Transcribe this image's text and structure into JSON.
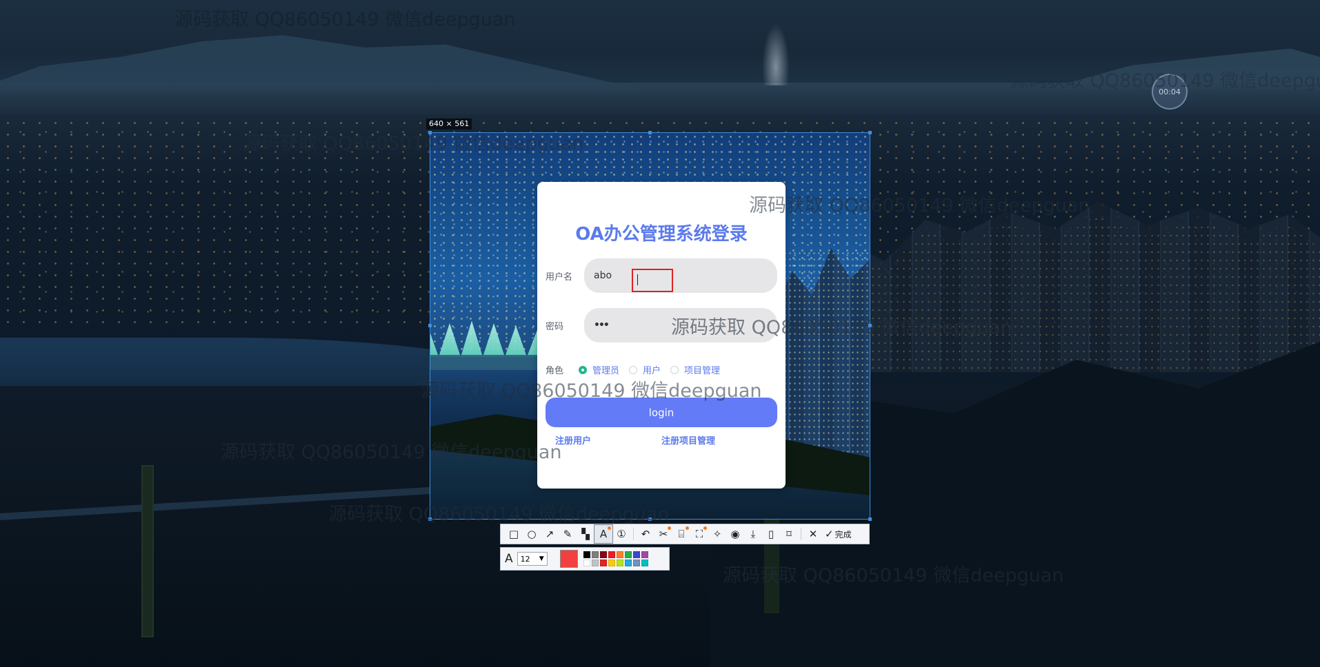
{
  "screen_capture": {
    "size_label": "640 × 561",
    "timer": "00:04"
  },
  "login": {
    "title": "OA办公管理系统登录",
    "username_label": "用户名",
    "username_value": "abo",
    "password_label": "密码",
    "password_value": "•••",
    "role_label": "角色",
    "roles": [
      {
        "label": "管理员",
        "checked": true
      },
      {
        "label": "用户",
        "checked": false
      },
      {
        "label": "项目管理",
        "checked": false
      }
    ],
    "login_button": "login",
    "link_register_user": "注册用户",
    "link_register_pm": "注册项目管理"
  },
  "watermark": "源码获取 QQ86050149 微信deepguan",
  "toolbar": {
    "tools": [
      "rectangle-tool",
      "ellipse-tool",
      "arrow-tool",
      "pencil-tool",
      "mosaic-tool",
      "text-tool",
      "number-tool",
      "undo-tool",
      "cut-tool",
      "ocr-tool",
      "scan-tool",
      "pin-tool",
      "record-tool",
      "save-tool",
      "copy-tool",
      "bookmark-tool"
    ],
    "close_icon": "close-icon",
    "done_label": "完成"
  },
  "text_options": {
    "font_size": "12",
    "current_color": "#f24040",
    "palette": [
      "#000000",
      "#7f7f7f",
      "#880015",
      "#ed1c24",
      "#ff7f27",
      "#22b14c",
      "#3f48cc",
      "#a349a4",
      "#ffffff",
      "#c3c3c3",
      "#e22323",
      "#ffc90e",
      "#b5e61d",
      "#22a9e0",
      "#7092be",
      "#00c0c0"
    ]
  }
}
